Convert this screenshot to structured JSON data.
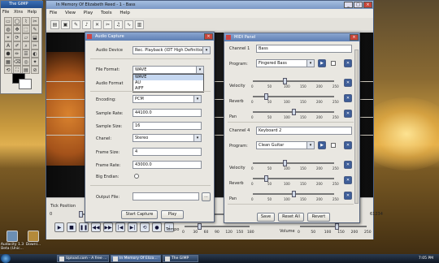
{
  "gimp": {
    "title": "The GIMP",
    "menu": [
      "File",
      "Xtns",
      "Help"
    ],
    "tools": [
      "▭",
      "◯",
      "⌇",
      "✂",
      "◍",
      "✥",
      "⬚",
      "✎",
      "⌖",
      "⟳",
      "▱",
      "⬓",
      "A",
      "✐",
      "⌕",
      "✂",
      "⬢",
      "✏",
      "☰",
      "◐",
      "▦",
      "⌫",
      "◎",
      "✦",
      "⟲",
      "⛶",
      "▤",
      "⊘"
    ]
  },
  "desktop_icons": [
    {
      "label": "Audacity 1.3 Beta (Unic..."
    },
    {
      "label": "Downl..."
    }
  ],
  "main_window": {
    "title": "In Memory Of Elizabeth Reed - 1 - Bass",
    "menu": [
      "File",
      "View",
      "Play",
      "Tools",
      "Help"
    ],
    "toolbar_icons": [
      "open-icon",
      "save-icon",
      "pencil-icon",
      "music-icon",
      "delete-icon",
      "cut-icon",
      "guitar-icon",
      "wave-icon",
      "piano-icon"
    ],
    "tick_position_label": "Tick Position",
    "tick_position_value": "0",
    "tick_end_value": "61234",
    "tick_position_fraction": 0.0,
    "tempo_label": "Tempo",
    "tempo_scale": [
      "0",
      "30",
      "60",
      "90",
      "120",
      "150",
      "180"
    ],
    "volume_label": "Volume",
    "volume_scale": [
      "0",
      "50",
      "100",
      "150",
      "200",
      "250"
    ],
    "tempo_fraction": 0.22,
    "volume_fraction": 0.55
  },
  "capture": {
    "title": "Audio Capture",
    "audio_device_label": "Audio Device",
    "audio_device_value": "Rec. Playback (IDT High Definition...",
    "file_format_label": "File Format:",
    "file_format_value": "WAVE",
    "file_format_options": [
      "WAVE",
      "AU",
      "AIFF"
    ],
    "audio_format_label": "Audio Format",
    "encoding_label": "Encoding:",
    "encoding_value": "PCM",
    "sample_rate_label": "Sample Rate:",
    "sample_rate_value": "44100.0",
    "sample_size_label": "Sample Size:",
    "sample_size_value": "16",
    "channel_label": "Chanel:",
    "channel_value": "Stereo",
    "frame_size_label": "Frame Size:",
    "frame_size_value": "4",
    "frame_rate_label": "Frame Rate:",
    "frame_rate_value": "43000.0",
    "big_endian_label": "Big Endian:",
    "output_file_label": "Output File:",
    "output_file_value": "",
    "browse_label": "...",
    "start_label": "Start Capture",
    "play_label": "Play"
  },
  "midi": {
    "title": "MIDI Panel",
    "channels": [
      {
        "channel_label": "Channel  1",
        "name": "Bass",
        "program_label": "Program:",
        "program": "Fingered Bass",
        "velocity_label": "Velocity",
        "reverb_label": "Reverb",
        "pan_label": "Pan",
        "velocity": 100,
        "reverb": 40,
        "pan": 128
      },
      {
        "channel_label": "Channel  4",
        "name": "Keyboard 2",
        "program_label": "Program:",
        "program": "Clean Guitar",
        "velocity_label": "Velocity",
        "reverb_label": "Reverb",
        "pan_label": "Pan",
        "velocity": 100,
        "reverb": 40,
        "pan": 128
      }
    ],
    "ticks": [
      "0",
      "50",
      "100",
      "150",
      "200",
      "250"
    ],
    "save_label": "Save",
    "reset_all_label": "Reset All",
    "revert_label": "Revert"
  },
  "taskbar": {
    "items": [
      {
        "label": "Upload.com - A free ..."
      },
      {
        "label": "In Memory Of Eliza..."
      },
      {
        "label": "The GIMP"
      }
    ],
    "clock": "7:05 PM"
  }
}
